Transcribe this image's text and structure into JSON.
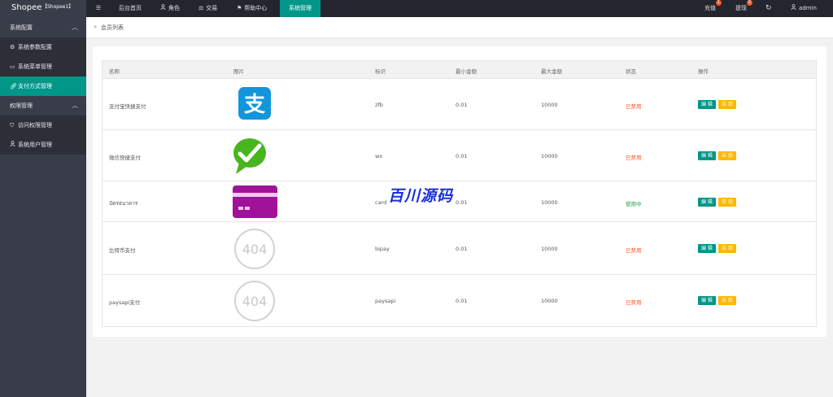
{
  "app": {
    "brand": "Shopee",
    "brand_tag": "【Shopee1】"
  },
  "topnav": {
    "items": [
      {
        "label": "",
        "icon": "menu-icon"
      },
      {
        "label": "后台首页"
      },
      {
        "label": "角色",
        "icon": "user-icon"
      },
      {
        "label": "交易",
        "icon": "scale-icon"
      },
      {
        "label": "帮助中心",
        "icon": "flag-icon"
      },
      {
        "label": "系统管理"
      }
    ],
    "right": {
      "recharge": "充值",
      "recharge_badge": "1",
      "withdraw": "提现",
      "withdraw_badge": "0",
      "refresh_icon": "refresh-icon",
      "user": "admin"
    }
  },
  "sidebar": {
    "groups": [
      {
        "label": "系统配置",
        "items": [
          {
            "label": "系统参数配置",
            "icon": "gear-icon"
          },
          {
            "label": "系统菜单管理",
            "icon": "window-icon"
          },
          {
            "label": "支付方式管理",
            "icon": "link-icon"
          }
        ]
      },
      {
        "label": "权限管理",
        "items": [
          {
            "label": "访问权限管理",
            "icon": "shield-icon"
          },
          {
            "label": "系统用户管理",
            "icon": "user-icon"
          }
        ]
      }
    ]
  },
  "breadcrumb": {
    "text": "会员列表"
  },
  "table": {
    "headers": [
      "名称",
      "图片",
      "标识",
      "最小金额",
      "最大金额",
      "状态",
      "操作"
    ],
    "rows": [
      {
        "name": "支付宝快捷支付",
        "image": "alipay-logo",
        "code": "zfb",
        "min": "0.01",
        "max": "10000",
        "status": "已禁用",
        "status_kind": "off",
        "edit": "编 辑",
        "toggle": "启 用"
      },
      {
        "name": "微信快捷支付",
        "image": "wechat-logo",
        "code": "wx",
        "min": "0.01",
        "max": "10000",
        "status": "已禁用",
        "status_kind": "off",
        "edit": "编 辑",
        "toggle": "启 用"
      },
      {
        "name": "บัตรธนาคาร",
        "image": "card-logo",
        "code": "card",
        "min": "0.01",
        "max": "10000",
        "status": "使用中",
        "status_kind": "on",
        "edit": "编 辑",
        "toggle": "禁 用"
      },
      {
        "name": "比特币支付",
        "image": "404-placeholder",
        "image_text": "404",
        "code": "bipay",
        "min": "0.01",
        "max": "10000",
        "status": "已禁用",
        "status_kind": "off",
        "edit": "编 辑",
        "toggle": "启 用"
      },
      {
        "name": "paysapi支付",
        "image": "404-placeholder",
        "image_text": "404",
        "code": "paysapi",
        "min": "0.01",
        "max": "10000",
        "status": "已禁用",
        "status_kind": "off",
        "edit": "编 辑",
        "toggle": "启 用"
      }
    ]
  },
  "watermark": "百川源码",
  "colors": {
    "accent": "#009688",
    "topbar": "#23262e",
    "sidebar": "#393d49",
    "disabled": "#ff5722",
    "enabled": "#1e9f3b",
    "toggle": "#ffb800"
  }
}
